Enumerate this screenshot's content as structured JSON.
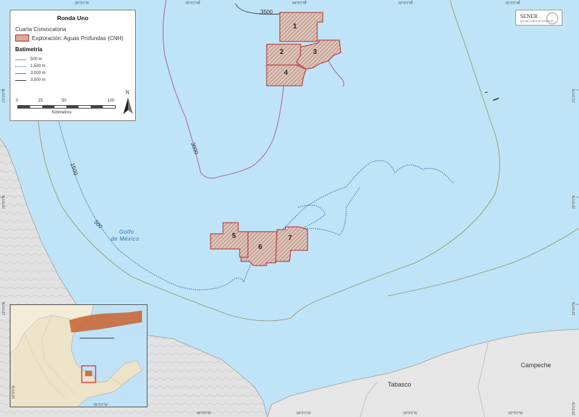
{
  "legend": {
    "title": "Ronda Uno",
    "subtitle": "Cuarta Convocatoria",
    "area_label": "Exploración: Aguas Profundas (CNH)",
    "bathymetry_heading": "Batimetría",
    "lines": [
      {
        "label": "500 m",
        "color": "#9a9a6a",
        "dash": "solid"
      },
      {
        "label": "1,500 m",
        "color": "#2a5fb0",
        "dash": "dotted"
      },
      {
        "label": "3,000 m",
        "color": "#a64ca6",
        "dash": "solid"
      },
      {
        "label": "3,500 m",
        "color": "#333333",
        "dash": "solid"
      }
    ],
    "scale_ticks": [
      "0",
      "25",
      "50",
      "100"
    ],
    "scale_unit": "Kilómetros",
    "north": "N"
  },
  "logo": {
    "text": "SENER",
    "subtext": "SECRETARÍA DE ENERGÍA"
  },
  "blocks": [
    "1",
    "2",
    "3",
    "4",
    "5",
    "6",
    "7"
  ],
  "places": {
    "gulf_line1": "Golfo",
    "gulf_line2": "de México",
    "tabasco": "Tabasco",
    "campeche": "Campeche"
  },
  "contours": {
    "c3500": "3500",
    "c3000": "3000",
    "c1500": "1500",
    "c500": "500"
  },
  "graticule": {
    "top": [
      "96°0'0\"W",
      "95°0'0\"W",
      "94°0'0\"W",
      "93°0'0\"W",
      "92°0'0\"W"
    ],
    "bottom": [
      "95°0'0\"W",
      "94°0'0\"W",
      "93°0'0\"W",
      "92°0'0\"W"
    ],
    "left": [
      "21°0'0\"N",
      "20°0'0\"N",
      "19°0'0\"N"
    ],
    "right": [
      "21°0'0\"N",
      "20°0'0\"N",
      "19°0'0\"N",
      "18°0'0\"N"
    ],
    "inset_bottom": "95°0'0\"W",
    "inset_left": "18°0'0\"N"
  },
  "colors": {
    "sea": "#bfe4f7",
    "land": "#e4e4e4",
    "block_border": "#b3262c",
    "block_fill": "#dcbfb3"
  }
}
